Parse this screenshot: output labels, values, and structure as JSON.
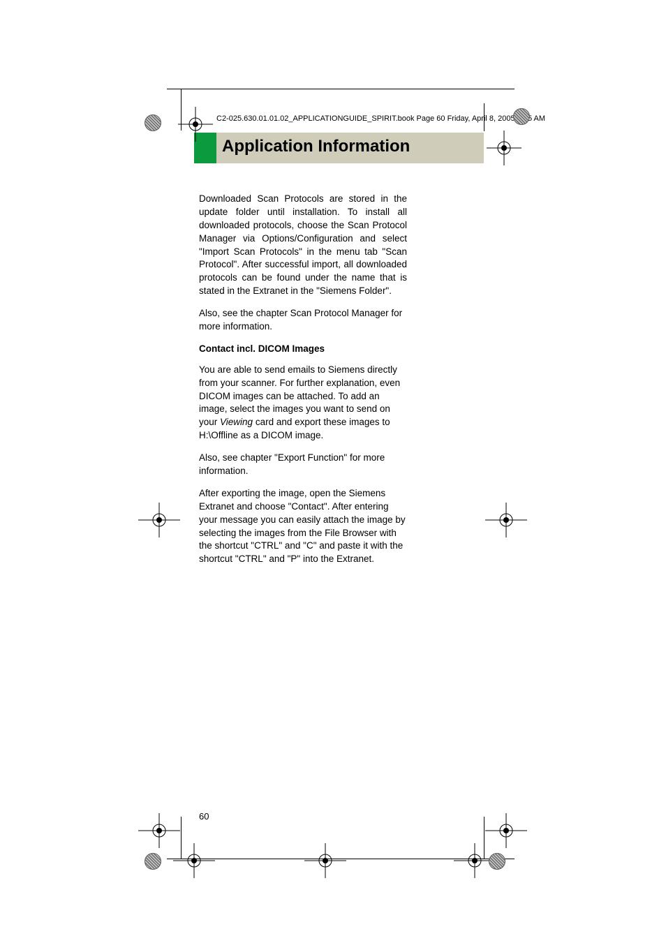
{
  "header": {
    "crop_info": "C2-025.630.01.01.02_APPLICATIONGUIDE_SPIRIT.book  Page 60  Friday, April 8, 2005  9:55 AM"
  },
  "title": "Application Information",
  "body": {
    "p1": "Downloaded Scan Protocols are stored in the update folder until installation. To install all downloaded protocols, choose the Scan Protocol Manager via Options/Configuration and select \"Import Scan Protocols\" in the menu tab \"Scan Protocol\". After successful import, all downloaded protocols can be found under the name that is stated in the Extranet in the \"Siemens Folder\".",
    "p2": "Also, see the chapter Scan Protocol Manager for more information.",
    "subheading": "Contact incl. DICOM Images",
    "p3a": "You are able to send emails to Siemens directly from your scanner. For further explanation, even DICOM images can be attached. To add an image, select the images you want to send on your ",
    "p3b": "Viewing",
    "p3c": " card and export these images to H:\\Offline as a DICOM image.",
    "p4": "Also, see chapter \"Export Function\" for more information.",
    "p5": "After exporting the image, open the Siemens Extranet and choose \"Contact\". After entering your message you can easily attach the image by selecting the images from the File Browser with the shortcut \"CTRL\" and \"C\" and paste it with the shortcut \"CTRL\" and \"P\" into the Extranet."
  },
  "page_number": "60"
}
